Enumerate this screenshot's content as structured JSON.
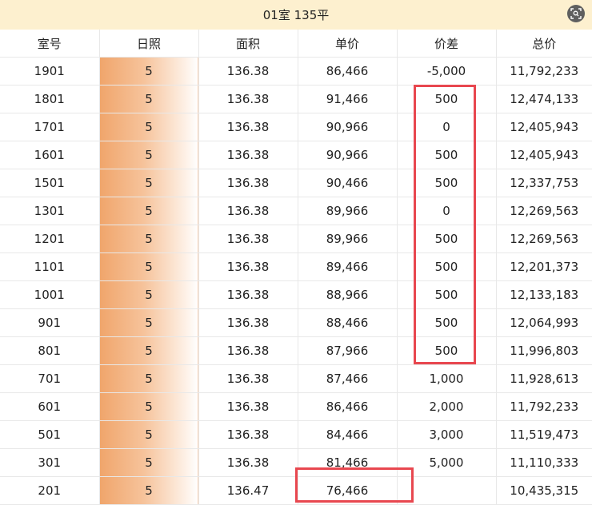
{
  "header": {
    "title": "01室 135平",
    "scan_icon": "scan-icon"
  },
  "table": {
    "columns": [
      "室号",
      "日照",
      "面积",
      "单价",
      "价差",
      "总价"
    ],
    "rows": [
      {
        "room": "1901",
        "sun": "5",
        "area": "136.38",
        "unit_price": "86,466",
        "diff": "-5,000",
        "total": "11,792,233"
      },
      {
        "room": "1801",
        "sun": "5",
        "area": "136.38",
        "unit_price": "91,466",
        "diff": "500",
        "total": "12,474,133"
      },
      {
        "room": "1701",
        "sun": "5",
        "area": "136.38",
        "unit_price": "90,966",
        "diff": "0",
        "total": "12,405,943"
      },
      {
        "room": "1601",
        "sun": "5",
        "area": "136.38",
        "unit_price": "90,966",
        "diff": "500",
        "total": "12,405,943"
      },
      {
        "room": "1501",
        "sun": "5",
        "area": "136.38",
        "unit_price": "90,466",
        "diff": "500",
        "total": "12,337,753"
      },
      {
        "room": "1301",
        "sun": "5",
        "area": "136.38",
        "unit_price": "89,966",
        "diff": "0",
        "total": "12,269,563"
      },
      {
        "room": "1201",
        "sun": "5",
        "area": "136.38",
        "unit_price": "89,966",
        "diff": "500",
        "total": "12,269,563"
      },
      {
        "room": "1101",
        "sun": "5",
        "area": "136.38",
        "unit_price": "89,466",
        "diff": "500",
        "total": "12,201,373"
      },
      {
        "room": "1001",
        "sun": "5",
        "area": "136.38",
        "unit_price": "88,966",
        "diff": "500",
        "total": "12,133,183"
      },
      {
        "room": "901",
        "sun": "5",
        "area": "136.38",
        "unit_price": "88,466",
        "diff": "500",
        "total": "12,064,993"
      },
      {
        "room": "801",
        "sun": "5",
        "area": "136.38",
        "unit_price": "87,966",
        "diff": "500",
        "total": "11,996,803"
      },
      {
        "room": "701",
        "sun": "5",
        "area": "136.38",
        "unit_price": "87,466",
        "diff": "1,000",
        "total": "11,928,613"
      },
      {
        "room": "601",
        "sun": "5",
        "area": "136.38",
        "unit_price": "86,466",
        "diff": "2,000",
        "total": "11,792,233"
      },
      {
        "room": "501",
        "sun": "5",
        "area": "136.38",
        "unit_price": "84,466",
        "diff": "3,000",
        "total": "11,519,473"
      },
      {
        "room": "301",
        "sun": "5",
        "area": "136.38",
        "unit_price": "81,466",
        "diff": "5,000",
        "total": "11,110,333"
      },
      {
        "room": "201",
        "sun": "5",
        "area": "136.47",
        "unit_price": "76,466",
        "diff": "",
        "total": "10,435,315"
      }
    ]
  },
  "colors": {
    "header_bg": "#fdf0cf",
    "sun_gradient_start": "#f0a56b",
    "highlight_border": "#e8474f"
  }
}
